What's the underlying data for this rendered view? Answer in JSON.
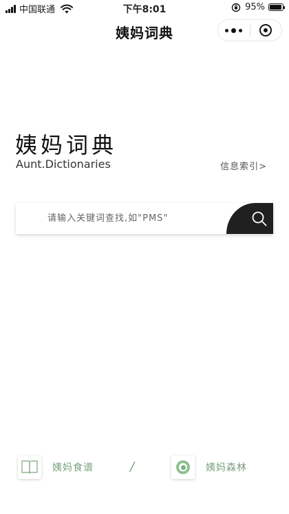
{
  "status_bar": {
    "carrier": "中国联通",
    "time": "下午8:01",
    "battery_percent": "95%",
    "battery_level": 0.95
  },
  "nav": {
    "title": "姨妈词典"
  },
  "hero": {
    "title": "姨妈词典",
    "subtitle": "Aunt.Dictionaries",
    "info_link": "信息索引>"
  },
  "search": {
    "placeholder": "请输入关键词查找,如\"PMS\"",
    "value": ""
  },
  "bottom_nav": {
    "recipes_label": "姨妈食谱",
    "separator": "/",
    "forest_label": "姨妈森林"
  },
  "colors": {
    "accent_green": "#7aa07c",
    "search_button": "#202020"
  },
  "icons": {
    "search": "search-icon",
    "recipes": "book-icon",
    "forest": "ring-icon",
    "more": "more-dots-icon",
    "close": "target-icon"
  }
}
